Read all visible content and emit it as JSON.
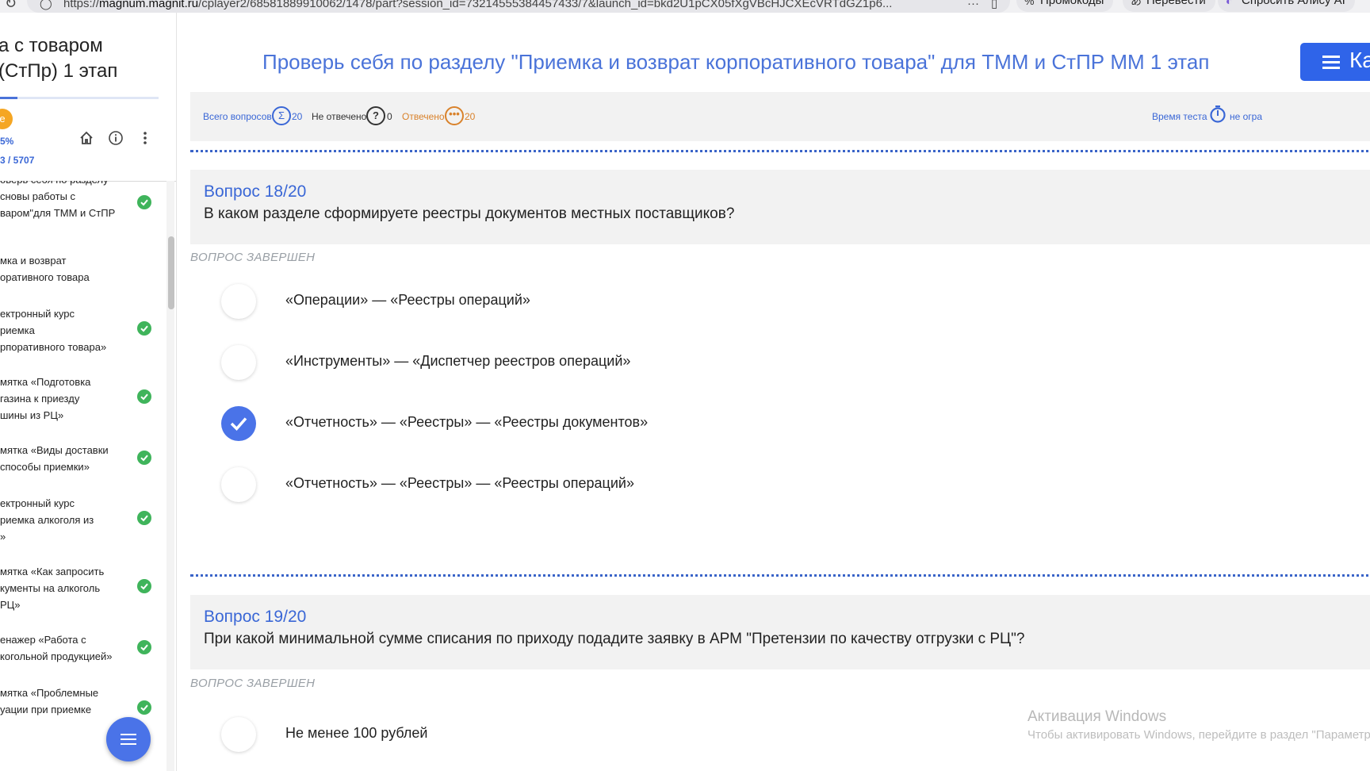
{
  "browser": {
    "url_prefix": "https://",
    "url_domain": "magnum.magnit.ru",
    "url_rest": "/cplayer2/68581889910062/1478/part?session_id=73214555384457433/7&launch_id=bkd2U1pCX05fXgVBcHJCXEcVRTdGZ1p6...",
    "more_label": "···",
    "promo_label": "Промокоды",
    "translate_label": "Перевести",
    "alice_label": "Спросить Алису AI"
  },
  "sidebar": {
    "title": "а с товаром\n(СтПр) 1 этап",
    "badge": "е",
    "percent": "5%",
    "score": "3 / 5707",
    "progress": 0.11,
    "items": [
      {
        "label": "оверь себя по разделу\nсновы работы с\nваром\"для ТММ и СтПР",
        "done": true
      },
      {
        "label": "мка и возврат\nоративного товара",
        "done": false
      },
      {
        "label": "ектронный курс\nриемка\nрпоративного товара»",
        "done": true
      },
      {
        "label": "мятка «Подготовка\nгазина к приезду\nшины из РЦ»",
        "done": true
      },
      {
        "label": "мятка «Виды доставки\nспособы приемки»",
        "done": true
      },
      {
        "label": "ектронный курс\nриемка алкоголя из\n»",
        "done": true
      },
      {
        "label": "мятка «Как запросить\nкументы на алкоголь\nРЦ»",
        "done": true
      },
      {
        "label": "енажер «Работа с\nкогольной продукцией»",
        "done": true
      },
      {
        "label": "мятка «Проблемные\nуации при приемке",
        "done": true
      }
    ]
  },
  "main": {
    "title": "Проверь себя по разделу \"Приемка и возврат корпоративного товара\" для ТММ и СтПР ММ 1 этап",
    "menu_label": "Ка",
    "stats": {
      "total_label": "Всего вопросов",
      "total_value": "20",
      "unanswered_label": "Не отвечено",
      "unanswered_value": "0",
      "answered_label": "Отвечено",
      "answered_value": "20",
      "time_label": "Время теста",
      "time_value": "не огра"
    },
    "questions": [
      {
        "number": "Вопрос 18/20",
        "text": "В каком разделе сформируете реестры документов местных поставщиков?",
        "status": "ВОПРОС ЗАВЕРШЕН",
        "options": [
          {
            "label": "«Операции» — «Реестры операций»",
            "selected": false
          },
          {
            "label": "«Инструменты» — «Диспетчер реестров операций»",
            "selected": false
          },
          {
            "label": "«Отчетность» — «Реестры» — «Реестры документов»",
            "selected": true
          },
          {
            "label": "«Отчетность» — «Реестры» — «Реестры операций»",
            "selected": false
          }
        ]
      },
      {
        "number": "Вопрос 19/20",
        "text": "При какой минимальной сумме списания по приходу подадите заявку в АРМ \"Претензии по качеству отгрузки с РЦ\"?",
        "status": "ВОПРОС ЗАВЕРШЕН",
        "options": [
          {
            "label": "Не менее 100 рублей",
            "selected": false
          }
        ]
      }
    ]
  },
  "watermark": {
    "line1": "Активация Windows",
    "line2": "Чтобы активировать Windows, перейдите в раздел \"Параметры\""
  },
  "colors": {
    "accent": "#4a73e8",
    "title": "#4a73d9",
    "check": "#3fb45b",
    "answered": "#d9822b"
  }
}
